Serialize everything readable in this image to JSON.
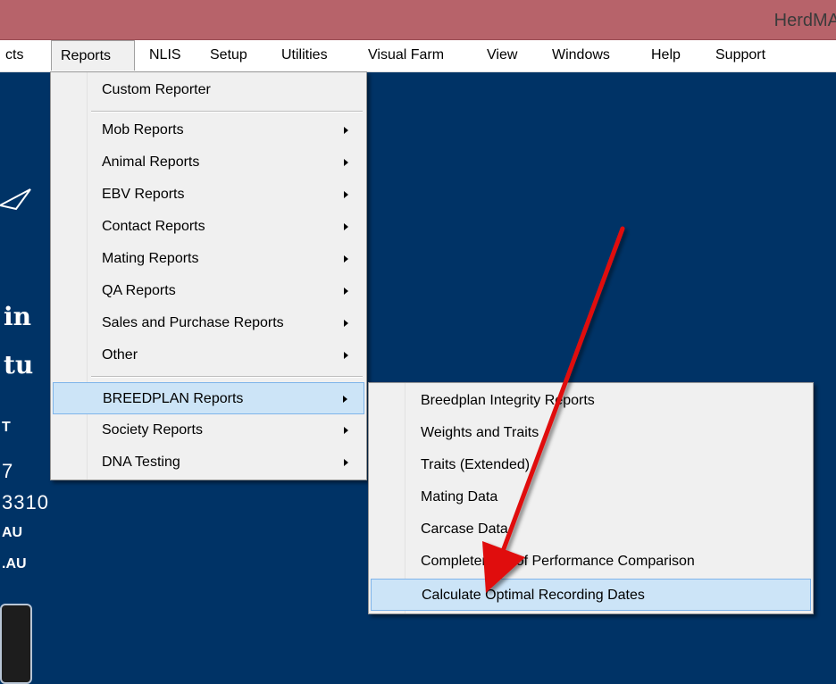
{
  "app": {
    "title": "HerdMA"
  },
  "menubar": {
    "items": [
      {
        "label": "cts"
      },
      {
        "label": "Reports"
      },
      {
        "label": "NLIS"
      },
      {
        "label": "Setup"
      },
      {
        "label": "Utilities"
      },
      {
        "label": "Visual Farm"
      },
      {
        "label": "View"
      },
      {
        "label": "Windows"
      },
      {
        "label": "Help"
      },
      {
        "label": "Support"
      }
    ]
  },
  "background": {
    "line1": "in",
    "line2": "tu",
    "line3": "T",
    "line4": "7",
    "line5": "3310",
    "line6": "AU",
    "line7": ".AU"
  },
  "reports_menu": {
    "items": [
      {
        "label": "Custom Reporter",
        "submenu": false
      },
      {
        "label": "Mob Reports",
        "submenu": true
      },
      {
        "label": "Animal Reports",
        "submenu": true
      },
      {
        "label": "EBV Reports",
        "submenu": true
      },
      {
        "label": "Contact Reports",
        "submenu": true
      },
      {
        "label": "Mating Reports",
        "submenu": true
      },
      {
        "label": "QA Reports",
        "submenu": true
      },
      {
        "label": "Sales and Purchase Reports",
        "submenu": true
      },
      {
        "label": "Other",
        "submenu": true
      },
      {
        "label": "BREEDPLAN Reports",
        "submenu": true,
        "highlighted": true
      },
      {
        "label": "Society Reports",
        "submenu": true
      },
      {
        "label": "DNA Testing",
        "submenu": true
      }
    ]
  },
  "breedplan_submenu": {
    "items": [
      {
        "label": "Breedplan Integrity Reports"
      },
      {
        "label": "Weights and Traits"
      },
      {
        "label": "Traits (Extended)"
      },
      {
        "label": "Mating Data"
      },
      {
        "label": "Carcase Data"
      },
      {
        "label": "Completeness of Performance Comparison"
      },
      {
        "label": "Calculate Optimal Recording Dates",
        "highlighted": true
      }
    ]
  },
  "colors": {
    "desktop": "#003366",
    "titlebar": "#b7636a",
    "highlight": "#cce4f7",
    "annotation_arrow": "#e01010"
  }
}
